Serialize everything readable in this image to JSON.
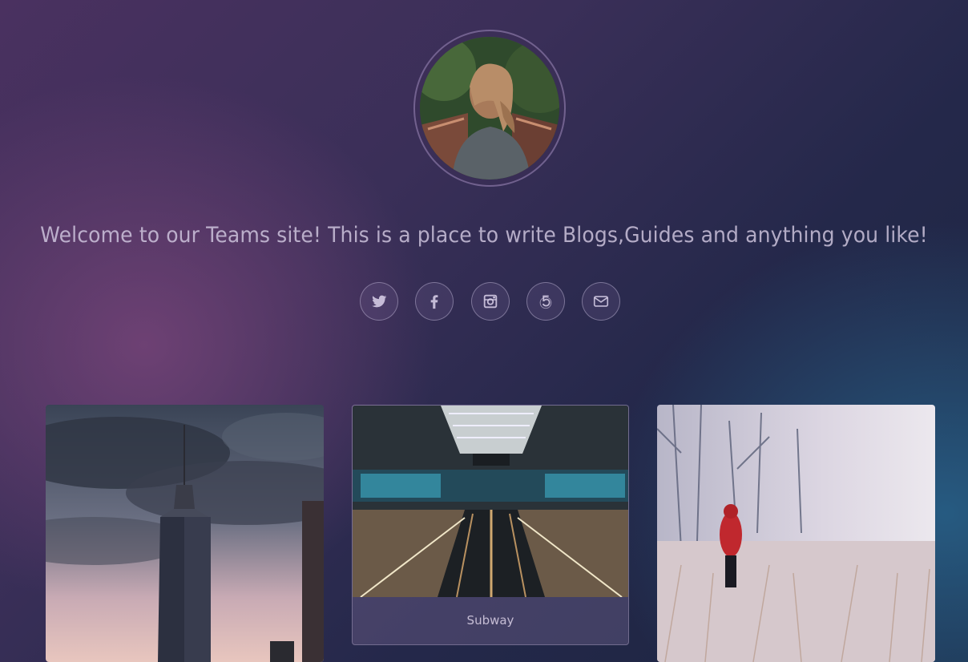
{
  "hero": {
    "welcome_text": "Welcome to our Teams site! This is a place to write Blogs,Guides and anything you like!"
  },
  "social_links": [
    {
      "name": "twitter-icon"
    },
    {
      "name": "facebook-icon"
    },
    {
      "name": "instagram-icon"
    },
    {
      "name": "500px-icon"
    },
    {
      "name": "envelope-icon"
    }
  ],
  "cards": [
    {
      "caption": ""
    },
    {
      "caption": "Subway"
    },
    {
      "caption": ""
    }
  ],
  "colors": {
    "gradient_left": "#764478",
    "gradient_right": "#28648c",
    "text": "#d2c8e1"
  }
}
